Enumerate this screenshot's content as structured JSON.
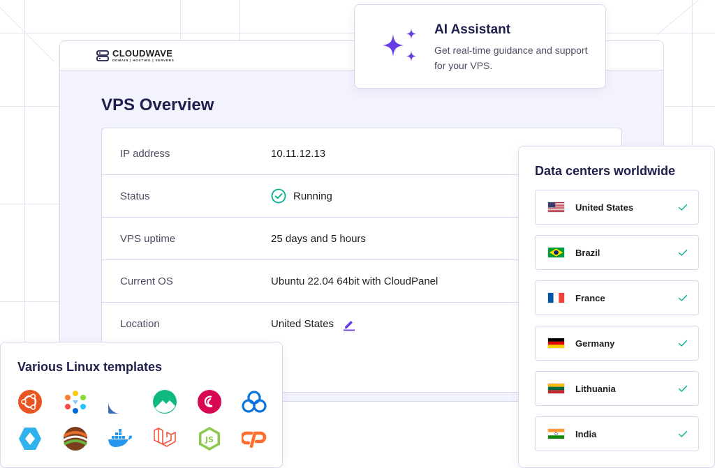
{
  "brand": {
    "name": "CLOUDWAVE",
    "tagline": "DOMAIN | HOSTING | SERVERS"
  },
  "vps_overview": {
    "title": "VPS Overview",
    "rows": [
      {
        "label": "IP address",
        "value": "10.11.12.13"
      },
      {
        "label": "Status",
        "value": "Running",
        "icon": "check-circle-icon"
      },
      {
        "label": "VPS uptime",
        "value": "25 days and 5 hours"
      },
      {
        "label": "Current OS",
        "value": "Ubuntu 22.04 64bit with CloudPanel"
      },
      {
        "label": "Location",
        "value": "United States",
        "icon": "edit-pencil-icon"
      }
    ]
  },
  "ai_assistant": {
    "title": "AI Assistant",
    "description": "Get real-time guidance and support for your VPS.",
    "icon": "sparkles-icon"
  },
  "data_centers": {
    "title": "Data centers worldwide",
    "items": [
      {
        "country": "United States",
        "flag": "us-flag-icon"
      },
      {
        "country": "Brazil",
        "flag": "br-flag-icon"
      },
      {
        "country": "France",
        "flag": "fr-flag-icon"
      },
      {
        "country": "Germany",
        "flag": "de-flag-icon"
      },
      {
        "country": "Lithuania",
        "flag": "lt-flag-icon"
      },
      {
        "country": "India",
        "flag": "in-flag-icon"
      }
    ]
  },
  "linux_templates": {
    "title": "Various Linux templates",
    "icons": [
      "ubuntu-icon",
      "almalinux-icon",
      "fedora-icon",
      "rocky-linux-icon",
      "debian-icon",
      "cloudlinux-icon",
      "plesk-icon",
      "centos-web-panel-icon",
      "docker-icon",
      "laravel-icon",
      "nodejs-icon",
      "cpanel-icon"
    ]
  },
  "colors": {
    "accent_purple": "#673de6",
    "heading_navy": "#1e1f4b",
    "success_green": "#00b090",
    "panel_bg": "#f3f3fe",
    "border": "#d6d8ee"
  }
}
